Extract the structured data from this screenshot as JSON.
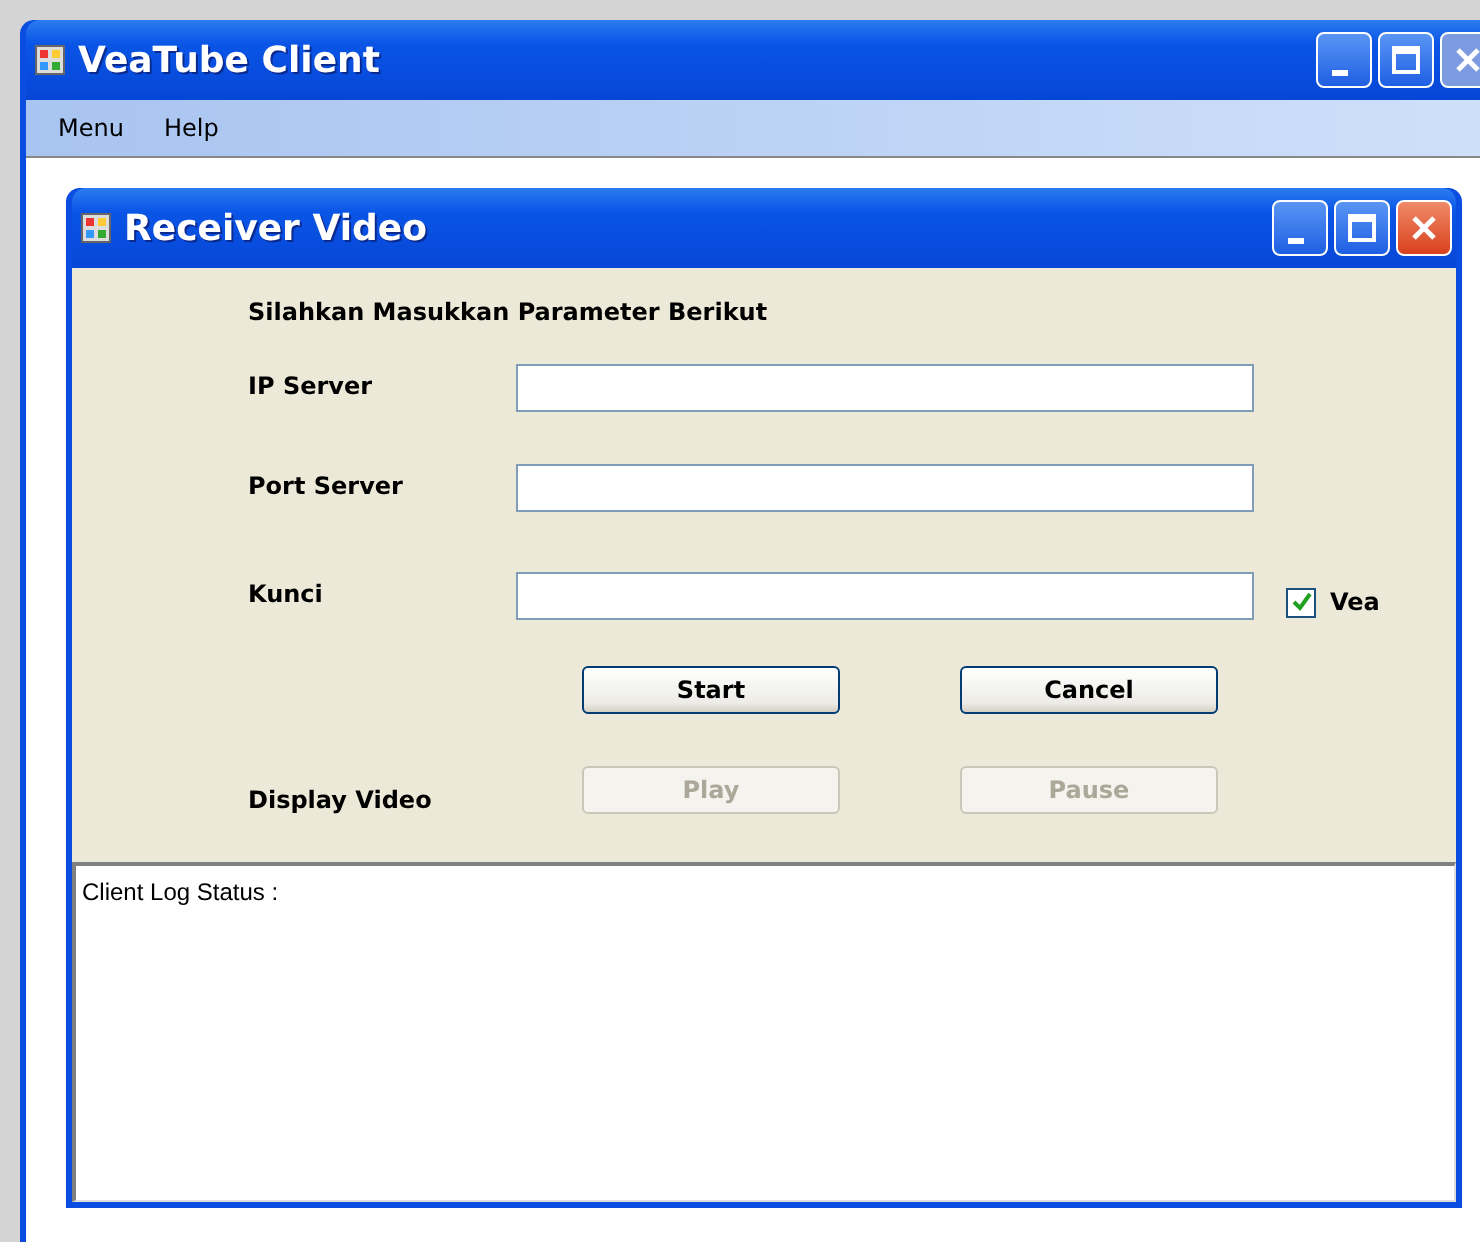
{
  "window": {
    "title": "VeaTube Client"
  },
  "menu": [
    {
      "label": "Menu"
    },
    {
      "label": "Help"
    }
  ],
  "dialog": {
    "title": "Receiver Video",
    "heading": "Silahkan Masukkan Parameter Berikut",
    "fields": [
      {
        "label": "IP Server"
      },
      {
        "label": "Port Server"
      },
      {
        "label": "Kunci"
      }
    ],
    "checkbox": {
      "label": "Vea",
      "checked": true
    },
    "buttons": [
      {
        "label": "Start",
        "disabled": false
      },
      {
        "label": "Cancel",
        "disabled": false
      }
    ],
    "display_label": "Display Video",
    "display_buttons": [
      {
        "label": "Play",
        "disabled": true
      },
      {
        "label": "Pause",
        "disabled": true
      }
    ],
    "log": "Client Log Status :"
  }
}
